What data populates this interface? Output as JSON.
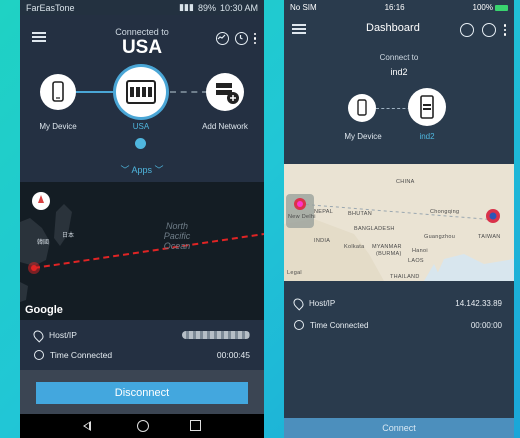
{
  "left": {
    "status": {
      "carrier": "FarEasTone",
      "battery": "89%",
      "time": "10:30 AM"
    },
    "header": {
      "connected_label": "Connected to",
      "country": "USA"
    },
    "nodes": {
      "my_device": "My Device",
      "server": "USA",
      "add_network": "Add Network"
    },
    "apps_label": "Apps",
    "map": {
      "ocean_label": "North Pacific Ocean",
      "japan_label": "日本",
      "korea_label": "韓國",
      "google_label": "Google"
    },
    "info": {
      "host_label": "Host/IP",
      "time_label": "Time Connected",
      "time_value": "00:00:45"
    },
    "disconnect_label": "Disconnect"
  },
  "right": {
    "status": {
      "carrier": "No SIM",
      "time": "16:16",
      "battery": "100%"
    },
    "header": {
      "title": "Dashboard"
    },
    "connect_to_label": "Connect to",
    "server_name": "ind2",
    "nodes": {
      "my_device": "My Device",
      "server": "ind2"
    },
    "map": {
      "labels": {
        "china": "CHINA",
        "chongqing": "Chongqing",
        "nepal": "NEPAL",
        "bhutan": "BHUTAN",
        "new_delhi": "New Delhi",
        "india": "INDIA",
        "bangladesh": "BANGLADESH",
        "kolkata": "Kolkata",
        "myanmar": "MYANMAR",
        "burma": "(BURMA)",
        "guangzhou": "Guangzhou",
        "hanoi": "Hanoi",
        "laos": "LAOS",
        "thailand": "THAILAND",
        "taiwan": "TAIWAN",
        "legal": "Legal"
      }
    },
    "info": {
      "host_label": "Host/IP",
      "host_value": "14.142.33.89",
      "time_label": "Time Connected",
      "time_value": "00:00:00"
    },
    "connect_label": "Connect"
  },
  "colors": {
    "accent": "#43a7de",
    "route": "#e02424",
    "pin": "#d9324a"
  }
}
